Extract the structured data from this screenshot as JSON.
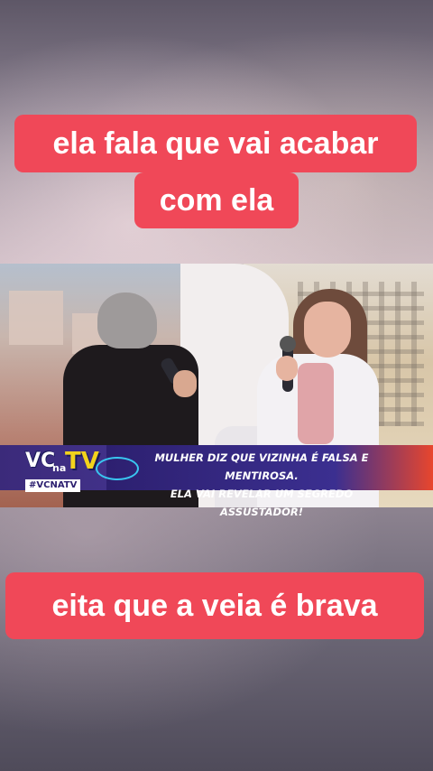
{
  "captions": {
    "top_line1": "ela fala que vai acabar",
    "top_line2": "com ela",
    "bottom": "eita que a veia é brava"
  },
  "video": {
    "logo": {
      "vc": "VC",
      "na": "na",
      "tv": "TV"
    },
    "hashtag": "#VCNATV",
    "headline_line1": "MULHER DIZ QUE VIZINHA É FALSA E MENTIROSA.",
    "headline_line2": "ELA VAI REVELAR UM SEGREDO ASSUSTADOR!"
  },
  "colors": {
    "caption_bg": "#f04858",
    "banner_bg": "#3b2f90",
    "banner_accent": "#e8462d",
    "logo_tv": "#f3d31c"
  }
}
